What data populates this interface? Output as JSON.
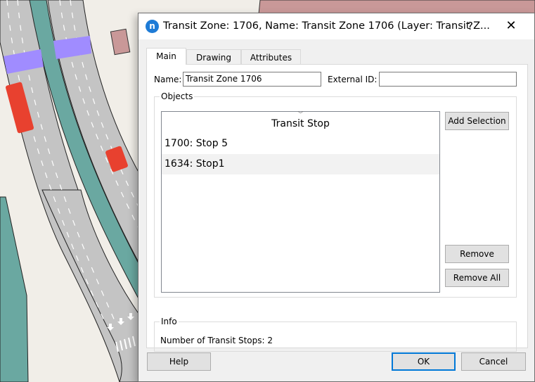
{
  "dialog": {
    "title": "Transit Zone: 1706, Name: Transit Zone 1706 (Layer: Transit Z...",
    "help_label": "?",
    "close_label": "✕",
    "app_icon_glyph": "n",
    "tabs": [
      {
        "label": "Main",
        "active": true
      },
      {
        "label": "Drawing",
        "active": false
      },
      {
        "label": "Attributes",
        "active": false
      }
    ],
    "main": {
      "name_label": "Name:",
      "name_value": "Transit Zone 1706",
      "external_id_label": "External ID:",
      "external_id_value": "",
      "objects_group_title": "Objects",
      "objects_list": {
        "column_header": "Transit Stop",
        "sort_indicator": "﹀",
        "rows": [
          {
            "label": "1700: Stop 5"
          },
          {
            "label": "1634: Stop1"
          }
        ]
      },
      "add_selection_label": "Add Selection",
      "remove_label": "Remove",
      "remove_all_label": "Remove All",
      "info_group_title": "Info",
      "info_text": "Number of Transit Stops: 2"
    },
    "footer": {
      "help_label": "Help",
      "ok_label": "OK",
      "cancel_label": "Cancel"
    }
  },
  "colors": {
    "accent": "#0078d7",
    "app_icon": "#1e7bd6",
    "map_background": "#f1eee8",
    "road": "#c4c4c4",
    "median": "#6aa8a1",
    "crosswalk_band": "#a08cff",
    "vehicle": "#e8412f",
    "building": "#c99898"
  }
}
